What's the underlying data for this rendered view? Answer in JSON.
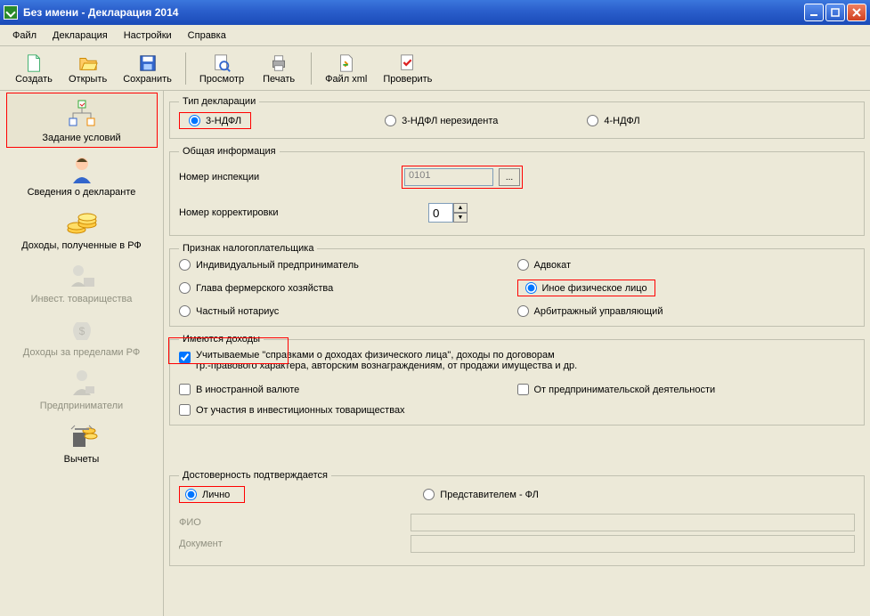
{
  "window": {
    "title": "Без имени - Декларация 2014"
  },
  "menu": {
    "file": "Файл",
    "declaration": "Декларация",
    "settings": "Настройки",
    "help": "Справка"
  },
  "toolbar": {
    "create": "Создать",
    "open": "Открыть",
    "save": "Сохранить",
    "preview": "Просмотр",
    "print": "Печать",
    "filexml": "Файл xml",
    "check": "Проверить"
  },
  "sidebar": {
    "conditions": "Задание условий",
    "declarant": "Сведения о декларанте",
    "income_rf": "Доходы, полученные в РФ",
    "invest": "Инвест. товарищества",
    "income_abroad": "Доходы за пределами РФ",
    "entrepreneurs": "Предприниматели",
    "deductions": "Вычеты"
  },
  "form": {
    "decl_type": {
      "legend": "Тип декларации",
      "opt1": "3-НДФЛ",
      "opt2": "3-НДФЛ нерезидента",
      "opt3": "4-НДФЛ"
    },
    "general": {
      "legend": "Общая информация",
      "inspection_label": "Номер инспекции",
      "inspection_value": "0101",
      "browse": "...",
      "correction_label": "Номер корректировки",
      "correction_value": "0"
    },
    "taxpayer": {
      "legend": "Признак налогоплательщика",
      "opt1": "Индивидуальный предприниматель",
      "opt2": "Адвокат",
      "opt3": "Глава фермерского хозяйства",
      "opt4": "Иное физическое лицо",
      "opt5": "Частный нотариус",
      "opt6": "Арбитражный управляющий"
    },
    "income": {
      "legend": "Имеются доходы",
      "chk1a": "Учитываемые \"справками о доходах физического лица\", доходы по договорам",
      "chk1b": "гр.-правового характера, авторским вознаграждениям, от продажи имущества и др.",
      "chk2": "В иностранной валюте",
      "chk3": "От предпринимательской деятельности",
      "chk4": "От участия в инвестиционных товариществах"
    },
    "confirm": {
      "legend": "Достоверность подтверждается",
      "opt1": "Лично",
      "opt2": "Представителем - ФЛ",
      "fio": "ФИО",
      "doc": "Документ"
    }
  }
}
